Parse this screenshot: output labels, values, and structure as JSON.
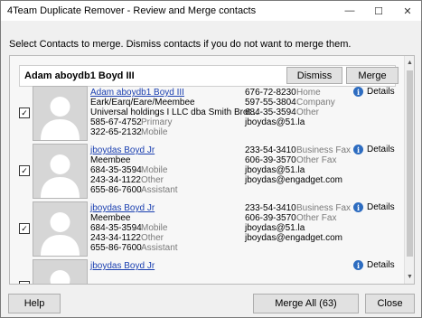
{
  "window": {
    "title": "4Team Duplicate Remover - Review and Merge contacts"
  },
  "controls": {
    "minimize": "—",
    "maximize": "☐",
    "close": "✕"
  },
  "instruction": "Select Contacts to merge. Dismiss contacts if you do not want to merge them.",
  "group": {
    "name": "Adam aboydb1 Boyd III",
    "dismiss": "Dismiss",
    "merge": "Merge"
  },
  "contacts": [
    {
      "checked": "✓",
      "name": "Adam aboydb1 Boyd III",
      "details": "Details",
      "left": [
        {
          "text": "Eark/Earq/Eare/Meembee",
          "label": ""
        },
        {
          "text": "Universal holdings I LLC dba Smith Brot...",
          "label": ""
        },
        {
          "text": "585-67-4752",
          "label": "Primary"
        },
        {
          "text": "322-65-2132",
          "label": "Mobile"
        }
      ],
      "right": [
        {
          "text": "676-72-8230",
          "label": "Home"
        },
        {
          "text": "597-55-3804",
          "label": "Company"
        },
        {
          "text": "684-35-3594",
          "label": "Other"
        },
        {
          "text": "jboydas@51.la",
          "label": ""
        }
      ]
    },
    {
      "checked": "✓",
      "name": "jboydas Boyd Jr",
      "details": "Details",
      "left": [
        {
          "text": "Meembee",
          "label": ""
        },
        {
          "text": "684-35-3594",
          "label": "Mobile"
        },
        {
          "text": "243-34-1122",
          "label": "Other"
        },
        {
          "text": "655-86-7600",
          "label": "Assistant"
        }
      ],
      "right": [
        {
          "text": "233-54-3410",
          "label": "Business Fax"
        },
        {
          "text": "606-39-3570",
          "label": "Other Fax"
        },
        {
          "text": "jboydas@51.la",
          "label": ""
        },
        {
          "text": "jboydas@engadget.com",
          "label": ""
        }
      ]
    },
    {
      "checked": "✓",
      "name": "jboydas Boyd Jr",
      "details": "Details",
      "left": [
        {
          "text": "Meembee",
          "label": ""
        },
        {
          "text": "684-35-3594",
          "label": "Mobile"
        },
        {
          "text": "243-34-1122",
          "label": "Other"
        },
        {
          "text": "655-86-7600",
          "label": "Assistant"
        }
      ],
      "right": [
        {
          "text": "233-54-3410",
          "label": "Business Fax"
        },
        {
          "text": "606-39-3570",
          "label": "Other Fax"
        },
        {
          "text": "jboydas@51.la",
          "label": ""
        },
        {
          "text": "jboydas@engadget.com",
          "label": ""
        }
      ]
    },
    {
      "checked": "",
      "name": "jboydas Boyd Jr",
      "details": "Details",
      "left": [],
      "right": []
    }
  ],
  "footer": {
    "help": "Help",
    "merge_all": "Merge All (63)",
    "close": "Close"
  },
  "icons": {
    "info": "i",
    "scroll_up": "▲",
    "scroll_down": "▼"
  }
}
